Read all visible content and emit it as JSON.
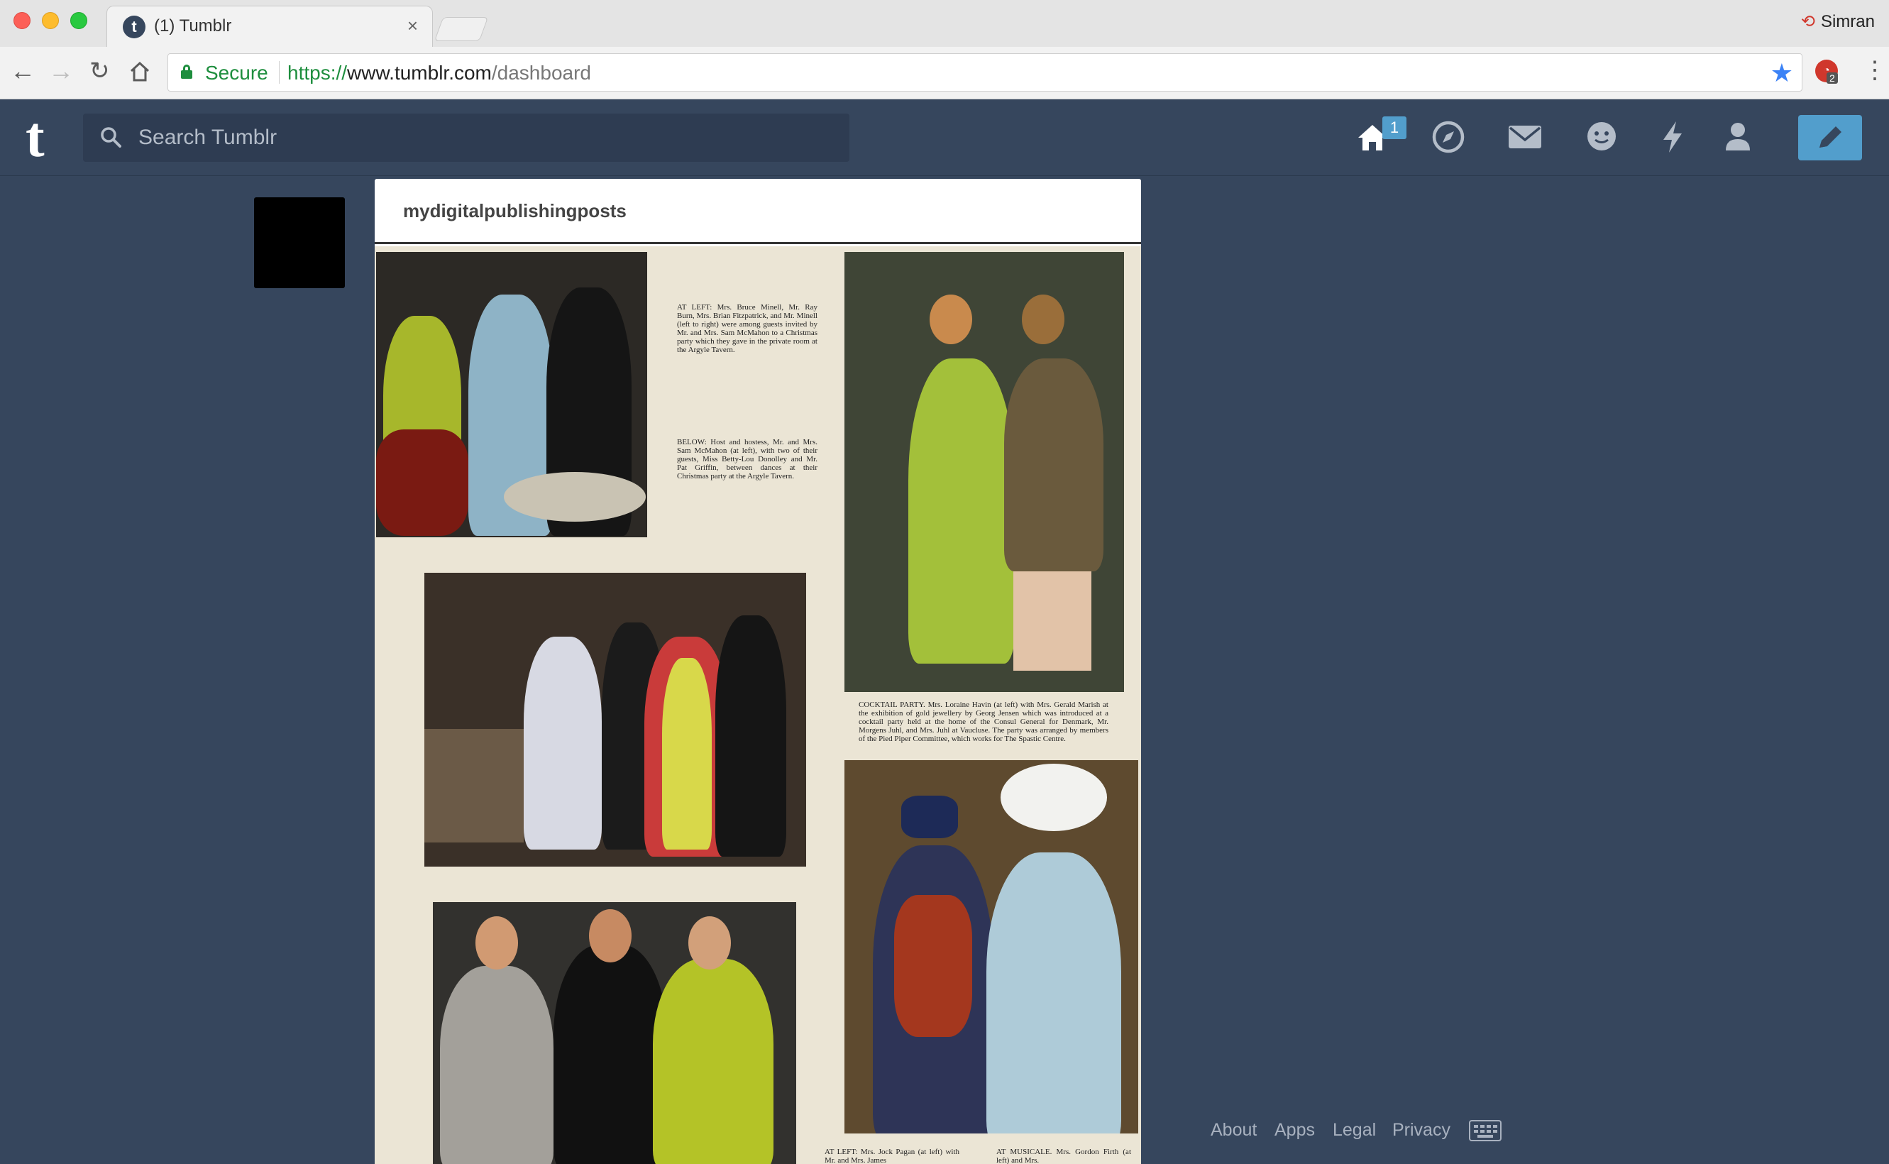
{
  "browser": {
    "tab_title": "(1) Tumblr",
    "tab_close": "×",
    "profile_name": "Simran",
    "secure_label": "Secure",
    "url_scheme": "https://",
    "url_host": "www.tumblr.com",
    "url_path": "/dashboard",
    "extension_badge": "2"
  },
  "header": {
    "logo": "t",
    "search_placeholder": "Search Tumblr",
    "home_badge": "1"
  },
  "post": {
    "blog_name": "mydigitalpublishingposts",
    "captions": {
      "at_left": "AT LEFT: Mrs. Bruce Minell, Mr. Ray Burn, Mrs. Brian Fitzpatrick, and Mr. Minell (left to right) were among guests invited by Mr. and Mrs. Sam McMahon to a Christmas party which they gave in the private room at the Argyle Tavern.",
      "below": "BELOW: Host and hostess, Mr. and Mrs. Sam McMahon (at left), with two of their guests, Miss Betty-Lou Donolley and Mr. Pat Griffin, between dances at their Christmas party at the Argyle Tavern.",
      "cocktail": "COCKTAIL PARTY. Mrs. Loraine Havin (at left) with Mrs. Gerald Marish at the exhibition of gold jewellery by Georg Jensen which was introduced at a cocktail party held at the home of the Consul General for Denmark, Mr. Morgens Juhl, and Mrs. Juhl at Vaucluse. The party was arranged by members of the Pied Piper Committee, which works for The Spastic Centre.",
      "bottom_left": "AT LEFT: Mrs. Jock Pagan (at left) with Mr. and Mrs. James",
      "bottom_right": "AT MUSICALE. Mrs. Gordon Firth (at left) and Mrs."
    }
  },
  "footer": {
    "links": [
      "About",
      "Apps",
      "Legal",
      "Privacy"
    ]
  },
  "colors": {
    "tumblr_navy": "#36465d",
    "accent_blue": "#529ecc",
    "secure_green": "#1e8e3e"
  },
  "icons": [
    "home-icon",
    "explore-icon",
    "inbox-icon",
    "messaging-icon",
    "activity-icon",
    "account-icon",
    "compose-icon",
    "keyboard-icon"
  ]
}
